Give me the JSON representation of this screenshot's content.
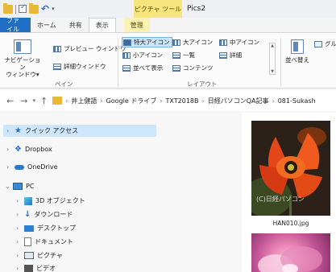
{
  "titlebar": {
    "context_tab_label": "ピクチャ ツール",
    "window_title": "Pics2"
  },
  "ribbon_tabs": [
    "ファイル",
    "ホーム",
    "共有",
    "表示",
    "管理"
  ],
  "ribbon": {
    "panes": {
      "nav_pane_label": "ナビゲーション\nウィンドウ▾",
      "preview_pane": "プレビュー ウィンドウ",
      "details_pane": "詳細ウィンドウ",
      "group_label": "ペイン"
    },
    "layout": {
      "items": [
        "特大アイコン",
        "大アイコン",
        "中アイコン",
        "小アイコン",
        "一覧",
        "詳細",
        "並べて表示",
        "コンテンツ"
      ],
      "group_label": "レイアウト"
    },
    "sort_label": "並べ替え",
    "group_by_label": "グル"
  },
  "addressbar": {
    "crumbs": [
      "井上健語",
      "Google ドライブ",
      "TXT2018B",
      "日経パソコンQA記事",
      "081-Sukash"
    ]
  },
  "navpane": {
    "items": [
      {
        "label": "クイック アクセス",
        "icon": "star-icon"
      },
      {
        "label": "Dropbox",
        "icon": "dropbox-icon"
      },
      {
        "label": "OneDrive",
        "icon": "cloud-icon"
      },
      {
        "label": "PC",
        "icon": "pc-icon"
      },
      {
        "label": "3D オブジェクト",
        "icon": "3d-objects-icon"
      },
      {
        "label": "ダウンロード",
        "icon": "download-icon"
      },
      {
        "label": "デスクトップ",
        "icon": "desktop-icon"
      },
      {
        "label": "ドキュメント",
        "icon": "documents-icon"
      },
      {
        "label": "ピクチャ",
        "icon": "pictures-icon"
      },
      {
        "label": "ビデオ",
        "icon": "videos-icon"
      }
    ]
  },
  "content": {
    "files": [
      {
        "name": "HAN010.jpg",
        "watermark": "(C)日経パソコン"
      },
      {
        "name": ""
      }
    ]
  },
  "colors": {
    "file_tab": "#1f6fc5",
    "context_tab": "#f6e47c",
    "selection": "#cde6fb"
  }
}
